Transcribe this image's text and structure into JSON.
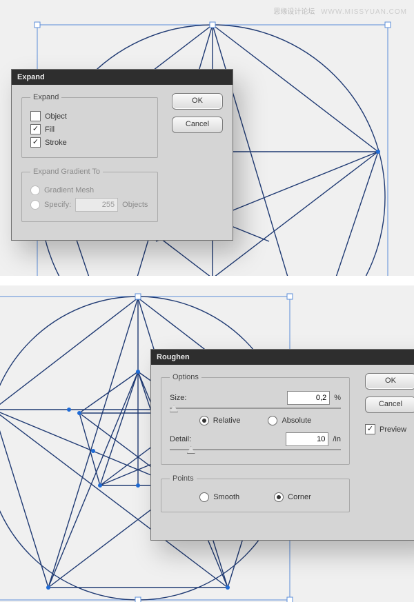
{
  "watermark": {
    "text": "思缘设计论坛",
    "url": "WWW.MISSYUAN.COM"
  },
  "expand_dialog": {
    "title": "Expand",
    "group1": {
      "legend": "Expand",
      "object_label": "Object",
      "object_checked": false,
      "fill_label": "Fill",
      "fill_checked": true,
      "stroke_label": "Stroke",
      "stroke_checked": true
    },
    "group2": {
      "legend": "Expand Gradient To",
      "mesh_label": "Gradient Mesh",
      "specify_label": "Specify:",
      "specify_value": "255",
      "specify_unit": "Objects"
    },
    "ok": "OK",
    "cancel": "Cancel"
  },
  "roughen_dialog": {
    "title": "Roughen",
    "options": {
      "legend": "Options",
      "size_label": "Size:",
      "size_value": "0,2",
      "size_unit": "%",
      "relative_label": "Relative",
      "absolute_label": "Absolute",
      "detail_label": "Detail:",
      "detail_value": "10",
      "detail_unit": "/in"
    },
    "points": {
      "legend": "Points",
      "smooth_label": "Smooth",
      "corner_label": "Corner"
    },
    "ok": "OK",
    "cancel": "Cancel",
    "preview_label": "Preview",
    "preview_checked": true
  }
}
